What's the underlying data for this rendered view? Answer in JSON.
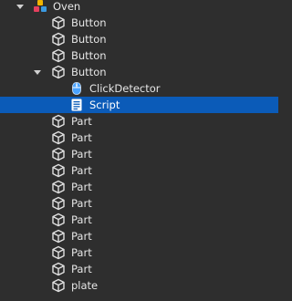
{
  "explorer": {
    "root": {
      "label": "Oven",
      "icon": "model-icon",
      "expanded": true
    },
    "items": [
      {
        "label": "Button",
        "icon": "part-icon"
      },
      {
        "label": "Button",
        "icon": "part-icon"
      },
      {
        "label": "Button",
        "icon": "part-icon"
      },
      {
        "label": "Button",
        "icon": "part-icon",
        "expanded": true,
        "children": [
          {
            "label": "ClickDetector",
            "icon": "click-detector-icon"
          },
          {
            "label": "Script",
            "icon": "script-icon",
            "selected": true
          }
        ]
      },
      {
        "label": "Part",
        "icon": "part-icon"
      },
      {
        "label": "Part",
        "icon": "part-icon"
      },
      {
        "label": "Part",
        "icon": "part-icon"
      },
      {
        "label": "Part",
        "icon": "part-icon"
      },
      {
        "label": "Part",
        "icon": "part-icon"
      },
      {
        "label": "Part",
        "icon": "part-icon"
      },
      {
        "label": "Part",
        "icon": "part-icon"
      },
      {
        "label": "Part",
        "icon": "part-icon"
      },
      {
        "label": "Part",
        "icon": "part-icon"
      },
      {
        "label": "Part",
        "icon": "part-icon"
      },
      {
        "label": "plate",
        "icon": "part-icon"
      }
    ]
  },
  "colors": {
    "background": "#2e2e2e",
    "text": "#e6e6e6",
    "selection": "#0b5bb8",
    "click_detector_accent": "#4aa3ff"
  }
}
